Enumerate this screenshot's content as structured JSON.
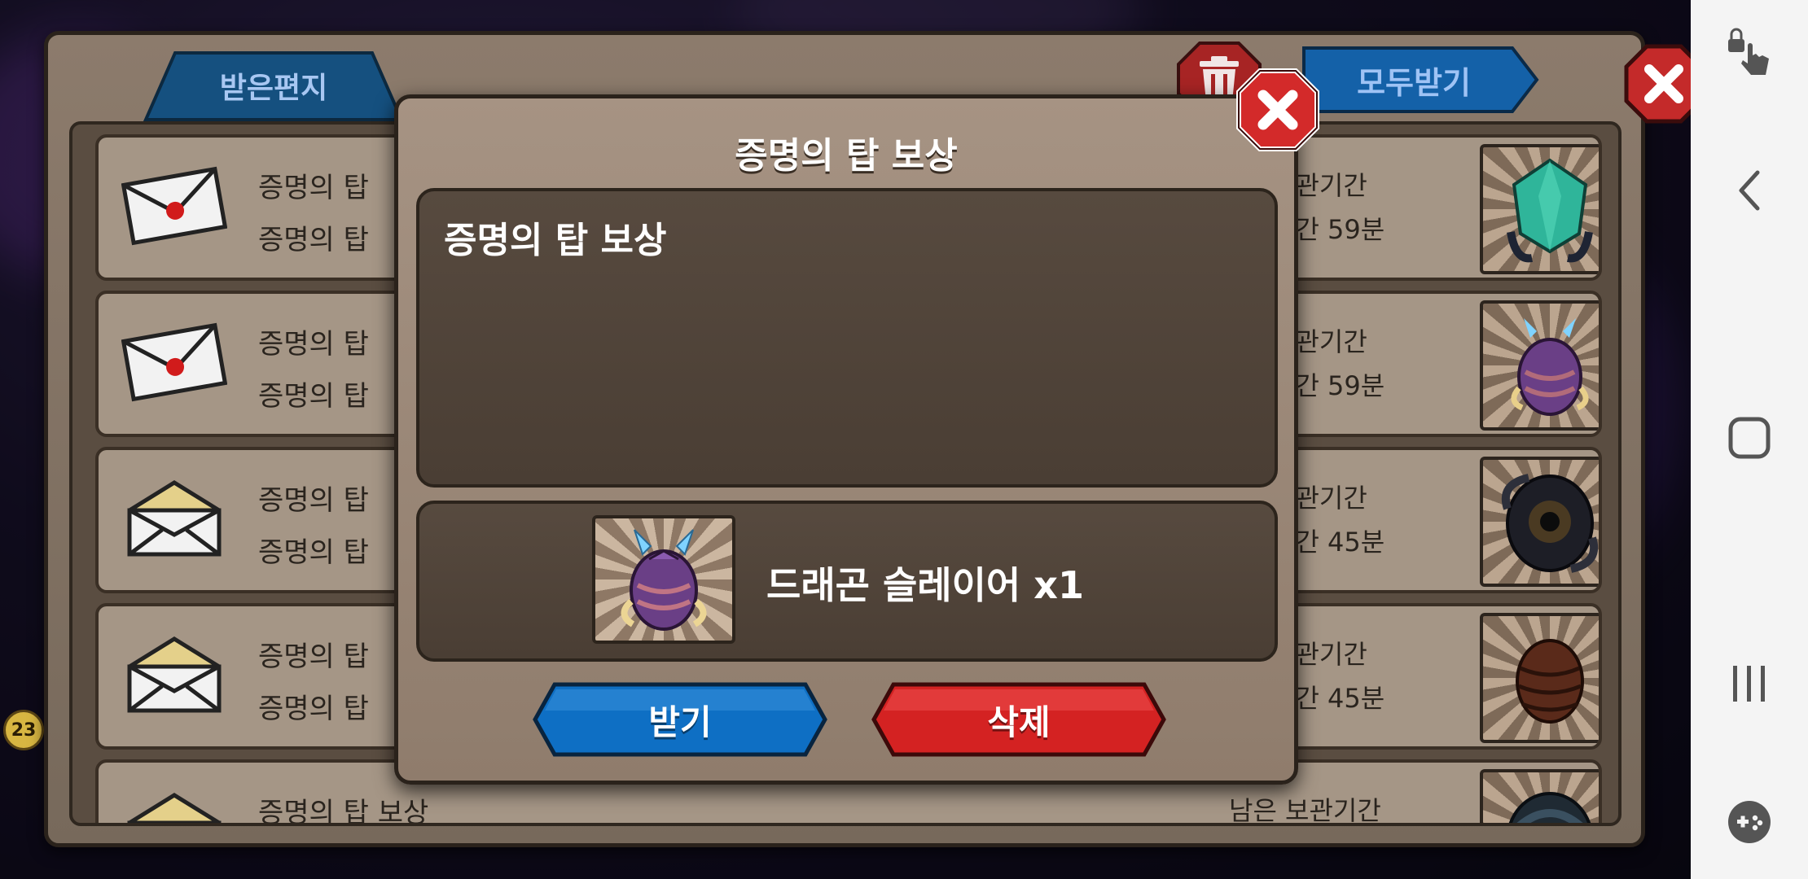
{
  "mailbox": {
    "tab_label": "받은편지",
    "receive_all_label": "모두받기",
    "rows": [
      {
        "title": "증명의 탑",
        "subtitle": "증명의 탑",
        "keep_label": "보관기간",
        "remaining": "시간 59분",
        "read": false,
        "reward_icon": "green-crystal-egg"
      },
      {
        "title": "증명의 탑",
        "subtitle": "증명의 탑",
        "keep_label": "보관기간",
        "remaining": "시간 59분",
        "read": false,
        "reward_icon": "dragon-slayer-egg"
      },
      {
        "title": "증명의 탑",
        "subtitle": "증명의 탑",
        "keep_label": "보관기간",
        "remaining": "시간 45분",
        "read": true,
        "reward_icon": "dark-eye-egg"
      },
      {
        "title": "증명의 탑",
        "subtitle": "증명의 탑",
        "keep_label": "보관기간",
        "remaining": "시간 45분",
        "read": true,
        "reward_icon": "brown-egg"
      },
      {
        "title": "증명의 탑 보상",
        "subtitle": "",
        "keep_label": "남은 보관기간",
        "remaining": "",
        "read": true,
        "reward_icon": "dark-swirl-egg"
      }
    ]
  },
  "background": {
    "level_badge": "23"
  },
  "dialog": {
    "title": "증명의 탑 보상",
    "message": "증명의 탑 보상",
    "reward_name": "드래곤 슬레이어 x1",
    "reward_icon": "dragon-slayer-egg",
    "accept_label": "받기",
    "delete_label": "삭제"
  },
  "colors": {
    "accept_blue": "#0e6fc4",
    "delete_red": "#d42222",
    "close_red": "#d32a2a",
    "panel_brown": "#8c7b6c"
  },
  "nav_bar": {
    "icons": [
      "touch-lock-icon",
      "back-icon",
      "home-icon",
      "recents-icon",
      "game-tools-icon"
    ]
  }
}
